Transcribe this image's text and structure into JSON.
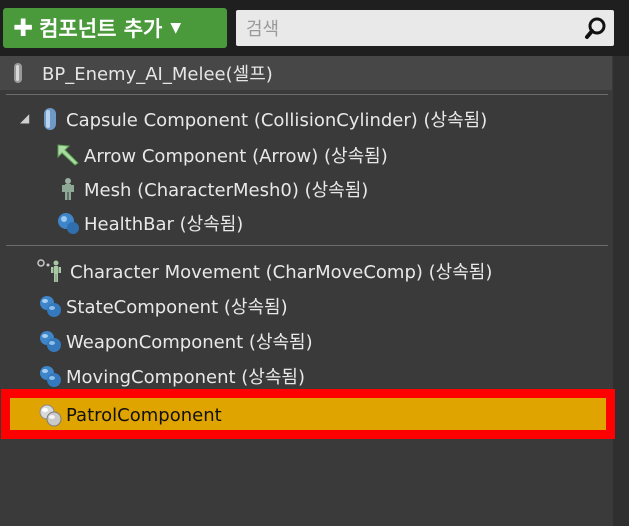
{
  "toolbar": {
    "add_component_label": "컴포넌트 추가",
    "search_placeholder": "검색"
  },
  "root": {
    "label": "BP_Enemy_AI_Melee(셀프)"
  },
  "tree": {
    "capsule": "Capsule Component (CollisionCylinder) (상속됨)",
    "arrow": "Arrow Component (Arrow) (상속됨)",
    "mesh": "Mesh (CharacterMesh0) (상속됨)",
    "healthbar": "HealthBar (상속됨)"
  },
  "components": {
    "movement": "Character Movement (CharMoveComp) (상속됨)",
    "state": "StateComponent (상속됨)",
    "weapon": "WeaponComponent (상속됨)",
    "moving": "MovingComponent (상속됨)",
    "patrol": "PatrolComponent"
  },
  "colors": {
    "add_button": "#4a9a3c",
    "selection": "#e0a400",
    "highlight_border": "#ff0000"
  }
}
